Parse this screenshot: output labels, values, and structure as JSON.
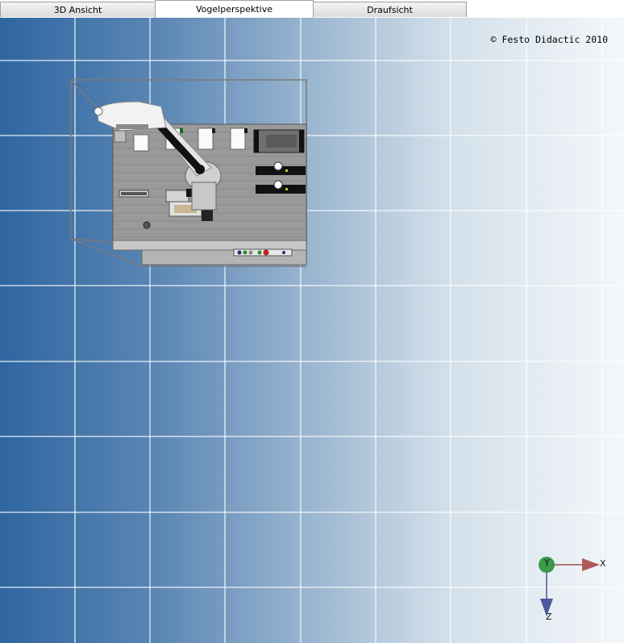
{
  "tabs": [
    {
      "label": "3D Ansicht",
      "active": false
    },
    {
      "label": "Vogelperspektive",
      "active": true
    },
    {
      "label": "Draufsicht",
      "active": false
    }
  ],
  "viewport": {
    "copyright": "© Festo Didactic 2010"
  },
  "axes": {
    "x_label": "X",
    "y_label": "Y",
    "z_label": "Z",
    "x_color": "#b05a5a",
    "y_color": "#3a9a4a",
    "z_color": "#4a5a9a"
  }
}
